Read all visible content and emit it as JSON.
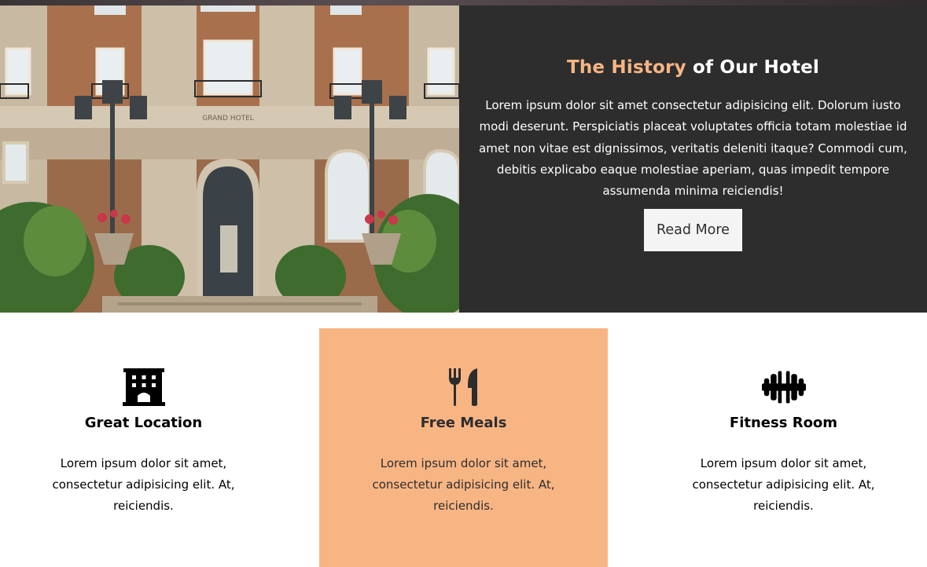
{
  "history": {
    "title_accent": "The History",
    "title_rest": "of Our Hotel",
    "text": "Lorem ipsum dolor sit amet consectetur adipisicing elit. Dolorum iusto modi deserunt. Perspiciatis placeat voluptates officia totam molestiae id amet non vitae est dignissimos, veritatis deleniti itaque? Commodi cum, debitis explicabo eaque molestiae aperiam, quas impedit tempore assumenda minima reiciendis!",
    "button_label": "Read More",
    "photo_sign": "GRAND HOTEL"
  },
  "colors": {
    "accent": "#f8b584",
    "dark_panel": "#2d2d2d",
    "button_bg": "#f4f4f4"
  },
  "features": [
    {
      "icon": "building-icon",
      "title": "Great Location",
      "text": "Lorem ipsum dolor sit amet, consectetur adipisicing elit. At, reiciendis."
    },
    {
      "icon": "utensils-icon",
      "title": "Free Meals",
      "text": "Lorem ipsum dolor sit amet, consectetur adipisicing elit. At, reiciendis."
    },
    {
      "icon": "dumbbell-icon",
      "title": "Fitness Room",
      "text": "Lorem ipsum dolor sit amet, consectetur adipisicing elit. At, reiciendis."
    }
  ]
}
